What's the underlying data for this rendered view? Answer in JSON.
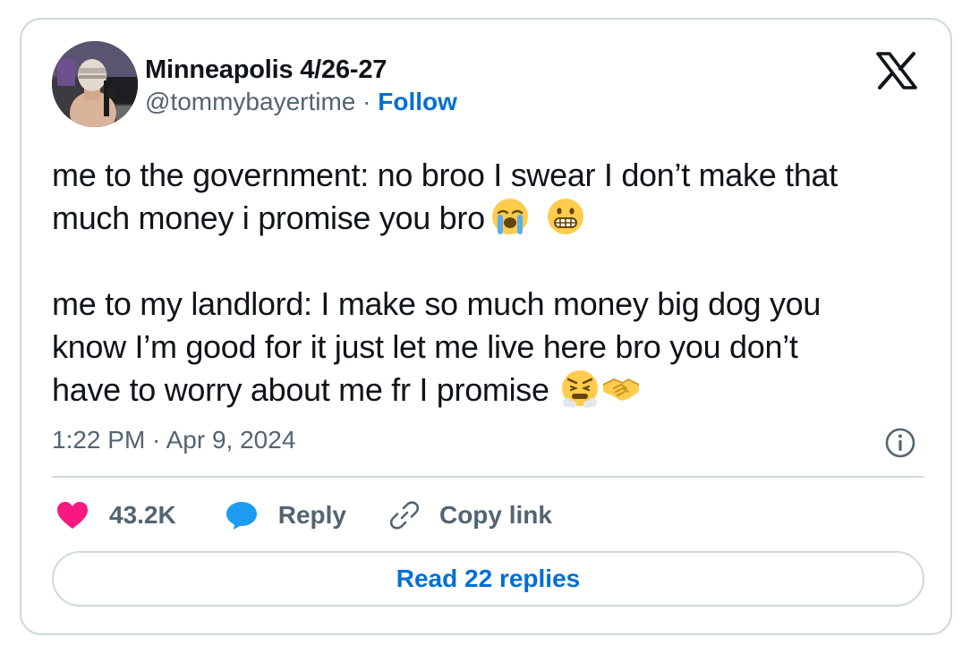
{
  "author": {
    "display_name": "Minneapolis 4/26-27",
    "handle": "@tommybayertime",
    "separator": " · ",
    "follow_label": "Follow"
  },
  "tweet": {
    "lines_para1": [
      "me to the government: no broo I swear I don’t make that",
      "much money i promise you bro"
    ],
    "lines_para2": [
      "me to my landlord:  I make so much money big dog you",
      "know I’m good for it just let me live here bro you don’t",
      "have to worry about me fr I promise"
    ],
    "emojis_para1": [
      "loudly-crying-face",
      "grimacing-face"
    ],
    "emojis_para2": [
      "face-with-steam-from-nose",
      "handshake"
    ],
    "timestamp": "1:22 PM · Apr 9, 2024"
  },
  "actions": {
    "like_count": "43.2K",
    "reply_label": "Reply",
    "copy_link_label": "Copy link"
  },
  "read_replies_label": "Read 22 replies",
  "icons": {
    "brand": "x-logo-icon",
    "info": "info-icon",
    "like": "heart-icon",
    "reply": "speech-bubble-icon",
    "copy": "link-icon"
  },
  "colors": {
    "link_blue": "#006fd6",
    "heart_pink": "#f91880",
    "reply_blue": "#1d9bf0",
    "muted_gray": "#536471",
    "border": "#cfd9de"
  }
}
